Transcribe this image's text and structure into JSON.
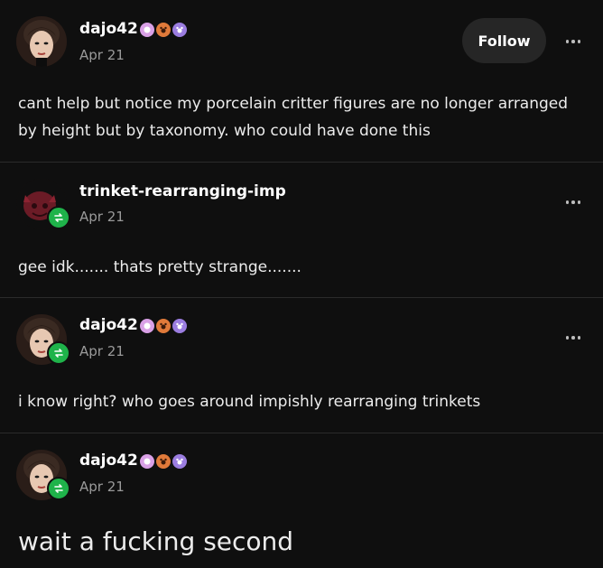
{
  "posts": [
    {
      "username": "dajo42",
      "date": "Apr 21",
      "body": "cant help but notice my porcelain critter figures are no longer arranged by height but by taxonomy. who could have done this",
      "follow_label": "Follow"
    },
    {
      "username": "trinket-rearranging-imp",
      "date": "Apr 21",
      "body": "gee idk....... thats pretty strange......."
    },
    {
      "username": "dajo42",
      "date": "Apr 21",
      "body": "i know right? who goes around impishly rearranging trinkets"
    },
    {
      "username": "dajo42",
      "date": "Apr 21",
      "body": "wait a fucking second"
    }
  ],
  "colors": {
    "background": "#0f0f0f",
    "reblog_green": "#1fb34a",
    "badge_pink": "#d9a0e6",
    "badge_orange": "#e07a3a",
    "badge_purple": "#9b7de0"
  },
  "icons": [
    "reblog-icon",
    "more-options-icon",
    "badge-icon"
  ]
}
